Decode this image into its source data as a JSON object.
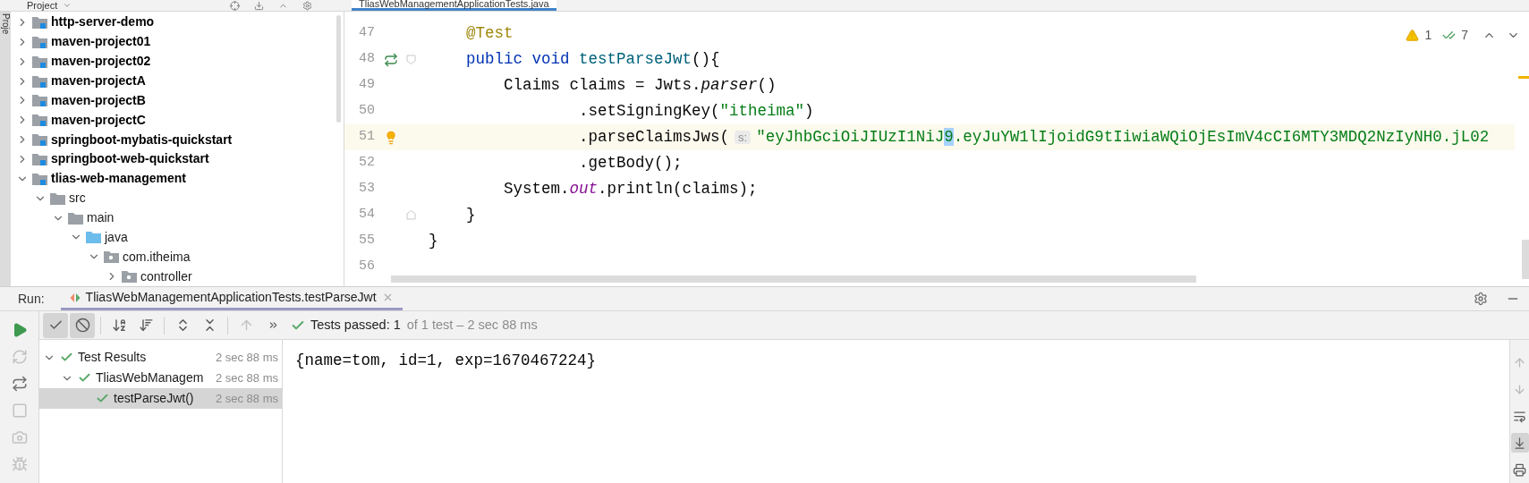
{
  "project_panel": {
    "title": "Project",
    "stripe_label": "Proje",
    "tree": [
      {
        "label": "http-server-demo",
        "kind": "module",
        "expanded": false
      },
      {
        "label": "maven-project01",
        "kind": "module",
        "expanded": false
      },
      {
        "label": "maven-project02",
        "kind": "module",
        "expanded": false
      },
      {
        "label": "maven-projectA",
        "kind": "module",
        "expanded": false
      },
      {
        "label": "maven-projectB",
        "kind": "module",
        "expanded": false
      },
      {
        "label": "maven-projectC",
        "kind": "module",
        "expanded": false
      },
      {
        "label": "springboot-mybatis-quickstart",
        "kind": "module",
        "expanded": false
      },
      {
        "label": "springboot-web-quickstart",
        "kind": "module",
        "expanded": false
      },
      {
        "label": "tlias-web-management",
        "kind": "module",
        "expanded": true,
        "children": [
          {
            "label": "src",
            "kind": "folder",
            "expanded": true,
            "children": [
              {
                "label": "main",
                "kind": "folder",
                "expanded": true,
                "children": [
                  {
                    "label": "java",
                    "kind": "source_folder",
                    "expanded": true,
                    "children": [
                      {
                        "label": "com.itheima",
                        "kind": "package",
                        "expanded": true,
                        "children": [
                          {
                            "label": "controller",
                            "kind": "package",
                            "expanded": false
                          }
                        ]
                      }
                    ]
                  }
                ]
              }
            ]
          }
        ]
      }
    ]
  },
  "editor": {
    "tab": {
      "label": "TliasWebManagementApplicationTests.java",
      "selected": true
    },
    "inspections": {
      "warnings": "1",
      "typos": "7"
    },
    "lines": [
      {
        "number": "47",
        "current": false,
        "tokens": [
          {
            "text": "    @Test",
            "kind": "annotation"
          }
        ]
      },
      {
        "number": "48",
        "current": false,
        "gutter": {
          "kind": "run"
        },
        "fold_marker": {
          "kind": "start"
        },
        "tokens": [
          {
            "text": "    public void ",
            "kind": "keyword"
          },
          {
            "text": "testParseJwt",
            "kind": "method"
          },
          {
            "text": "(){",
            "kind": "plain"
          }
        ]
      },
      {
        "number": "49",
        "current": false,
        "tokens": [
          {
            "text": "        Claims claims = Jwts.",
            "kind": "plain"
          },
          {
            "text": "parser",
            "kind": "italic"
          },
          {
            "text": "()",
            "kind": "plain"
          }
        ]
      },
      {
        "number": "50",
        "current": false,
        "tokens": [
          {
            "text": "                .setSigningKey(",
            "kind": "plain"
          },
          {
            "text": "\"itheima\"",
            "kind": "string"
          },
          {
            "text": ")",
            "kind": "plain"
          }
        ]
      },
      {
        "number": "51",
        "current": true,
        "gutter": {
          "kind": "bulb"
        },
        "tokens": [
          {
            "text": "                .parseClaimsJws(",
            "kind": "plain"
          },
          {
            "text": "s:",
            "kind": "hint"
          },
          {
            "text": "\"eyJhbGciOiJIUzI1NiJ",
            "kind": "string"
          },
          {
            "text": "9",
            "kind": "selection"
          },
          {
            "text": ".eyJuYW1lIjoidG9tIiwiaWQiOjEsImV4cCI6MTY3MDQ2NzIyNH0.jL02",
            "kind": "string"
          }
        ]
      },
      {
        "number": "52",
        "current": false,
        "tokens": [
          {
            "text": "                .getBody();",
            "kind": "plain"
          }
        ]
      },
      {
        "number": "53",
        "current": false,
        "tokens": [
          {
            "text": "        System.",
            "kind": "plain"
          },
          {
            "text": "out",
            "kind": "static"
          },
          {
            "text": ".println(claims);",
            "kind": "plain"
          }
        ]
      },
      {
        "number": "54",
        "current": false,
        "fold_marker": {
          "kind": "end"
        },
        "tokens": [
          {
            "text": "    }",
            "kind": "plain"
          }
        ]
      },
      {
        "number": "55",
        "current": false,
        "tokens": [
          {
            "text": "}",
            "kind": "plain"
          }
        ]
      },
      {
        "number": "56",
        "current": false
      }
    ]
  },
  "run_panel": {
    "label": "Run:",
    "tab": {
      "label": "TliasWebManagementApplicationTests.testParseJwt",
      "selected": true
    },
    "side_tools": [
      {
        "kind": "run",
        "disabled": false
      },
      {
        "kind": "rerun_failed",
        "disabled": true
      },
      {
        "kind": "auto_rerun",
        "disabled": false
      },
      {
        "kind": "stop",
        "disabled": true
      },
      {
        "kind": "snapshot",
        "disabled": true
      },
      {
        "kind": "debug",
        "disabled": true
      }
    ],
    "toolbar": [
      {
        "kind": "show_passed",
        "on": true
      },
      {
        "kind": "show_ignored",
        "on": true
      },
      {
        "kind": "sort_alpha",
        "on": false
      },
      {
        "kind": "sort_duration",
        "on": false
      },
      {
        "kind": "expand_all",
        "on": false
      },
      {
        "kind": "collapse_all",
        "on": false
      },
      {
        "kind": "previous",
        "on": false
      },
      {
        "kind": "more",
        "on": false
      }
    ],
    "status": {
      "label": "Tests passed: 1",
      "detail": "of 1 test – 2 sec 88 ms"
    },
    "results": [
      {
        "label": "Test Results",
        "time": "2 sec 88 ms",
        "expanded": true,
        "selected": false,
        "children": [
          {
            "label": "TliasWebManagem",
            "time": "2 sec 88 ms",
            "expanded": true,
            "selected": false,
            "children": [
              {
                "label": "testParseJwt()",
                "time": "2 sec 88 ms",
                "selected": true
              }
            ]
          }
        ]
      }
    ],
    "console": [
      "{name=tom, id=1, exp=1670467224}"
    ],
    "console_tools": [
      {
        "kind": "up",
        "on": false
      },
      {
        "kind": "down",
        "on": false
      },
      {
        "kind": "soft_wrap",
        "on": false
      },
      {
        "kind": "scroll_end",
        "on": true
      },
      {
        "kind": "print",
        "on": false
      }
    ]
  }
}
